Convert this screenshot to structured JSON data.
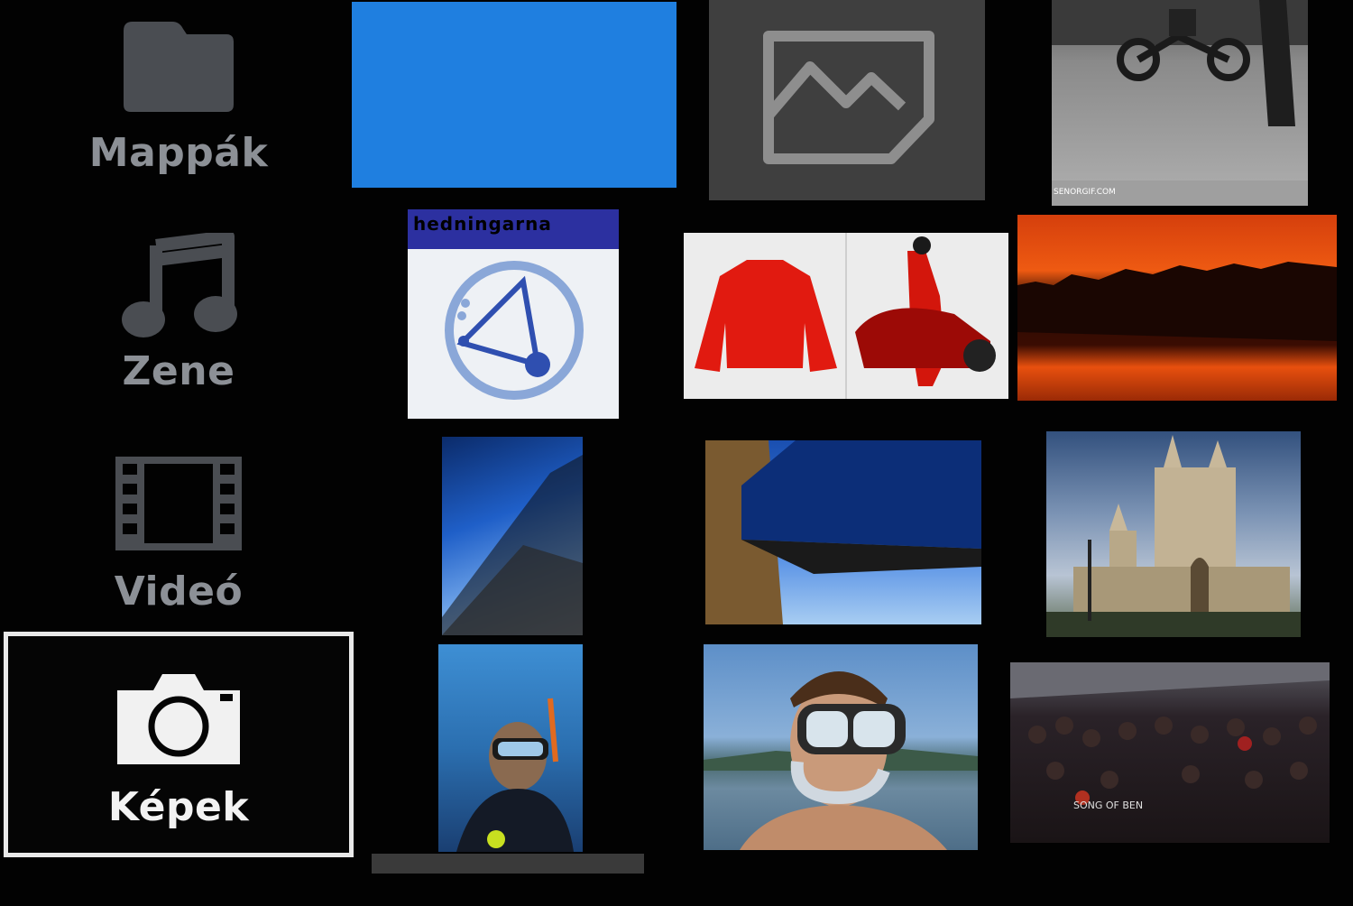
{
  "sidebar": {
    "items": [
      {
        "label": "Mappák",
        "icon": "folder-icon",
        "selected": false
      },
      {
        "label": "Zene",
        "icon": "music-note-icon",
        "selected": false
      },
      {
        "label": "Videó",
        "icon": "film-strip-icon",
        "selected": false
      },
      {
        "label": "Képek",
        "icon": "camera-icon",
        "selected": true
      }
    ]
  },
  "grid": {
    "tiles": [
      {
        "name": "blue-placeholder-tile",
        "kind": "blue"
      },
      {
        "name": "image-placeholder-tile",
        "kind": "placeholder-icon"
      },
      {
        "name": "motorcycle-photo-tile",
        "kind": "photo",
        "caption": "SENORGIF.COM"
      },
      {
        "name": "album-cover-tile",
        "kind": "album",
        "title": "hedningarna"
      },
      {
        "name": "red-jacket-photo-tile",
        "kind": "photo"
      },
      {
        "name": "sunset-photo-tile",
        "kind": "photo"
      },
      {
        "name": "building-sky-photo-tile",
        "kind": "photo"
      },
      {
        "name": "car-sky-photo-tile",
        "kind": "photo"
      },
      {
        "name": "cathedral-photo-tile",
        "kind": "photo"
      },
      {
        "name": "diver-photo-tile",
        "kind": "photo"
      },
      {
        "name": "snorkel-portrait-tile",
        "kind": "photo"
      },
      {
        "name": "crowd-photo-tile",
        "kind": "photo",
        "caption": "SONG OF BEN"
      }
    ]
  },
  "colors": {
    "background": "#020202",
    "selection_border": "#e9e9e9",
    "inactive_label": "#8c9096",
    "active_label": "#f2f2f2",
    "blue_tile": "#1f7fe0"
  }
}
